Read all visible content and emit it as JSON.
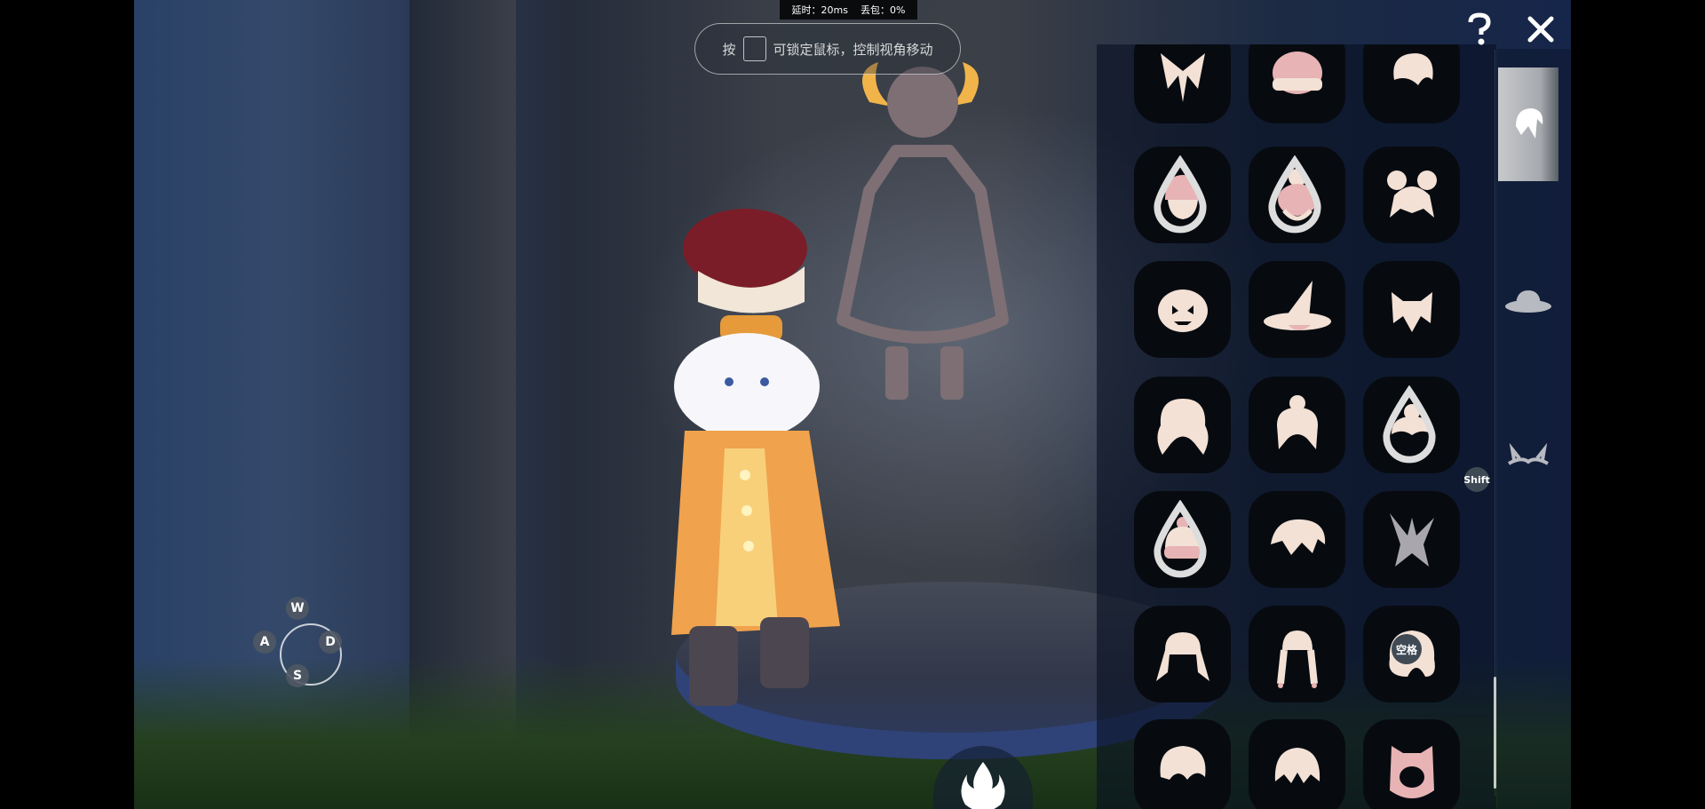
{
  "hud": {
    "latency": "延时：20ms",
    "packet_loss": "丢包：0%"
  },
  "hint": {
    "prefix": "按",
    "text": "可锁定鼠标，控制视角移动"
  },
  "movement": {
    "up": "W",
    "left": "A",
    "right": "D",
    "down": "S"
  },
  "shift_label": "Shift",
  "space_label": "空格",
  "colors": {
    "item_fill": "#f3e1d6",
    "item_pink": "#e7b3b4",
    "slot_bg": "#070b10",
    "hud_bg": "#000000"
  },
  "closet_items": [
    [
      "hair-tied-ribbon",
      "hair-pink-beanie",
      "hair-short-swept"
    ],
    [
      "hair-pink-hat",
      "hair-pink-bun",
      "hair-double-buns"
    ],
    [
      "hair-pumpkin-hat",
      "hair-witch-hat",
      "hair-cat-ears"
    ],
    [
      "hair-long-wavy",
      "hair-updo",
      "hair-short-bun"
    ],
    [
      "hair-knit-beanie",
      "hair-messy-long",
      "hair-bunny-ears"
    ],
    [
      "hair-twin-tails",
      "hair-braids",
      "hair-side-bun"
    ],
    [
      "hair-curly-short",
      "hair-bob-fringe",
      "hair-pink-hood"
    ]
  ],
  "drop_badges": [
    "hair-pink-hat",
    "hair-pink-bun",
    "hair-short-bun",
    "hair-knit-beanie"
  ],
  "categories": [
    "hair-tab",
    "hat-tab",
    "horn-tab"
  ]
}
